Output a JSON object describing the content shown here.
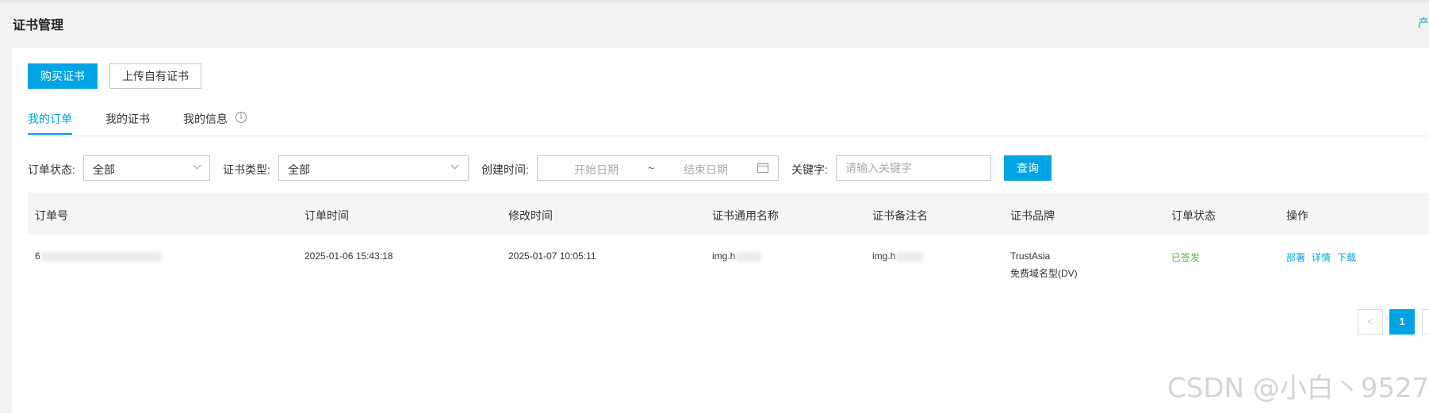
{
  "header": {
    "title": "证书管理",
    "top_link": "产"
  },
  "toolbar": {
    "buy_label": "购买证书",
    "upload_label": "上传自有证书"
  },
  "tabs": [
    {
      "label": "我的订单",
      "active": true
    },
    {
      "label": "我的证书",
      "active": false
    },
    {
      "label": "我的信息",
      "active": false
    }
  ],
  "filters": {
    "order_status_label": "订单状态:",
    "order_status_value": "全部",
    "cert_type_label": "证书类型:",
    "cert_type_value": "全部",
    "created_label": "创建时间:",
    "start_placeholder": "开始日期",
    "range_sep": "~",
    "end_placeholder": "结束日期",
    "keyword_label": "关键字:",
    "keyword_placeholder": "请输入关键字",
    "query_label": "查询"
  },
  "table": {
    "columns": [
      "订单号",
      "订单时间",
      "修改时间",
      "证书通用名称",
      "证书备注名",
      "证书品牌",
      "订单状态",
      "操作"
    ],
    "rows": [
      {
        "order_no": "6",
        "order_time": "2025-01-06 15:43:18",
        "modified_time": "2025-01-07 10:05:11",
        "common_name": "img.h",
        "remark_name": "img.h",
        "brand_line1": "TrustAsia",
        "brand_line2": "免费域名型(DV)",
        "status": "已签发",
        "actions": [
          "部署",
          "详情",
          "下载"
        ]
      }
    ]
  },
  "pagination": {
    "prev": "<",
    "current": "1"
  },
  "watermark": "CSDN @小白丶9527",
  "colors": {
    "accent": "#00a4e4",
    "success": "#52b141"
  }
}
